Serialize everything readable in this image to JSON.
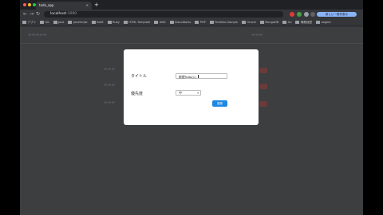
{
  "window": {
    "tab_title": "todo_app",
    "new_tab_symbol": "+"
  },
  "toolbar": {
    "url_host": "localhost",
    "url_path": ":3000",
    "profile_label": "新しい一般列表示"
  },
  "bookmarks": [
    "アプリ",
    "Git",
    "Java",
    "JavaScript",
    "Swift",
    "Ruby",
    "HTML Template",
    "AWS",
    "iDocsWorks",
    "PHP",
    "Portfolio Sample",
    "Oracle",
    "MongoDB",
    "Go",
    "職務経歴",
    "oagent"
  ],
  "modal": {
    "title_label": "タイトル",
    "title_value": "新規Todo(1)",
    "priority_label": "優先度",
    "priority_value": "中",
    "submit_label": "登録"
  },
  "colors": {
    "accent": "#1e88e5",
    "chrome": "#202124",
    "toolbar": "#35363a"
  }
}
